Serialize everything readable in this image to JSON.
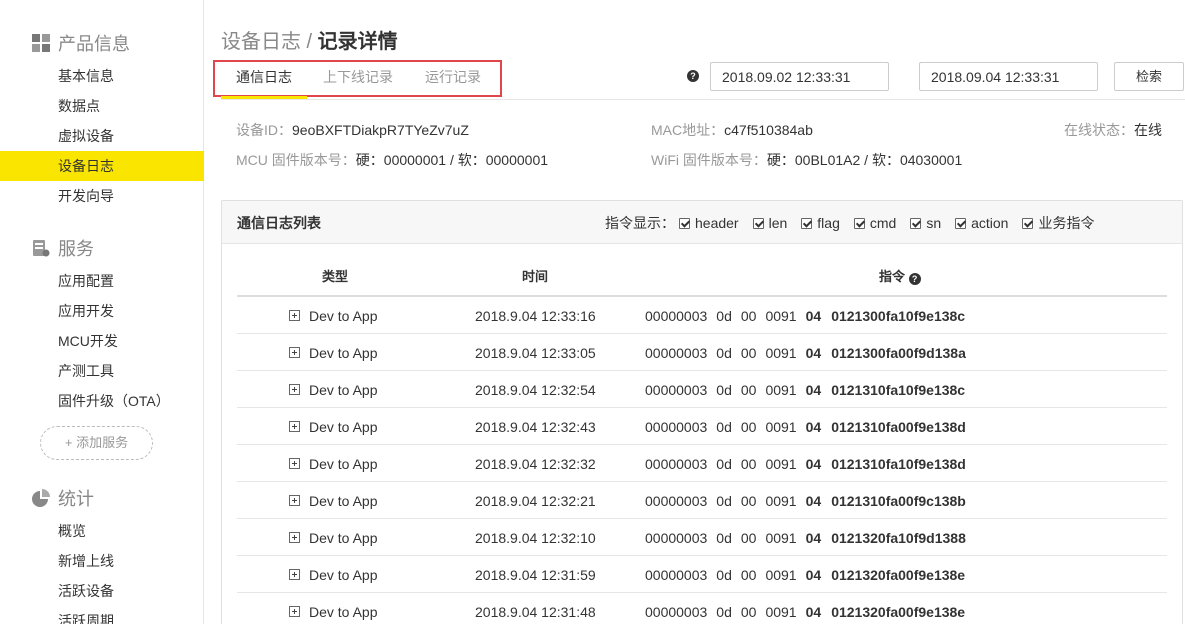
{
  "sidebar": {
    "sections": [
      {
        "title": "产品信息",
        "icon": "grid-icon",
        "items": [
          "基本信息",
          "数据点",
          "虚拟设备",
          "设备日志",
          "开发向导"
        ]
      },
      {
        "title": "服务",
        "icon": "server-icon",
        "items": [
          "应用配置",
          "应用开发",
          "MCU开发",
          "产测工具",
          "固件升级（OTA）"
        ],
        "add_label": "+ 添加服务"
      },
      {
        "title": "统计",
        "icon": "pie-chart-icon",
        "items": [
          "概览",
          "新增上线",
          "活跃设备",
          "活跃周期"
        ]
      }
    ],
    "active_item": "设备日志"
  },
  "header": {
    "title_parent": "设备日志",
    "title_sep": " / ",
    "title_current": "记录详情",
    "tabs": [
      "通信日志",
      "上下线记录",
      "运行记录"
    ],
    "active_tab": "通信日志",
    "help_glyph": "?",
    "date_start": "2018.09.02 12:33:31",
    "date_end": "2018.09.04 12:33:31",
    "search_label": "检索"
  },
  "device": {
    "id_label": "设备ID：",
    "id_value": "9eoBXFTDiakpR7TYeZv7uZ",
    "mac_label": "MAC地址：",
    "mac_value": "c47f510384ab",
    "status_label": "在线状态：",
    "status_value": "在线",
    "mcu_label": "MCU 固件版本号：",
    "mcu_value": "硬：00000001 / 软：00000001",
    "wifi_label": "WiFi 固件版本号：",
    "wifi_value": "硬：00BL01A2 / 软：04030001"
  },
  "log": {
    "panel_title": "通信日志列表",
    "filter_label": "指令显示：",
    "filters": [
      "header",
      "len",
      "flag",
      "cmd",
      "sn",
      "action",
      "业务指令"
    ],
    "columns": [
      "类型",
      "时间",
      "指令"
    ],
    "rows": [
      {
        "type": "Dev to App",
        "time": "2018.9.04 12:33:16",
        "header": "00000003",
        "len": "0d",
        "flag": "00",
        "cmd": "0091",
        "action": "04",
        "payload": "0121300fa10f9e138c"
      },
      {
        "type": "Dev to App",
        "time": "2018.9.04 12:33:05",
        "header": "00000003",
        "len": "0d",
        "flag": "00",
        "cmd": "0091",
        "action": "04",
        "payload": "0121300fa00f9d138a"
      },
      {
        "type": "Dev to App",
        "time": "2018.9.04 12:32:54",
        "header": "00000003",
        "len": "0d",
        "flag": "00",
        "cmd": "0091",
        "action": "04",
        "payload": "0121310fa10f9e138c"
      },
      {
        "type": "Dev to App",
        "time": "2018.9.04 12:32:43",
        "header": "00000003",
        "len": "0d",
        "flag": "00",
        "cmd": "0091",
        "action": "04",
        "payload": "0121310fa00f9e138d"
      },
      {
        "type": "Dev to App",
        "time": "2018.9.04 12:32:32",
        "header": "00000003",
        "len": "0d",
        "flag": "00",
        "cmd": "0091",
        "action": "04",
        "payload": "0121310fa10f9e138d"
      },
      {
        "type": "Dev to App",
        "time": "2018.9.04 12:32:21",
        "header": "00000003",
        "len": "0d",
        "flag": "00",
        "cmd": "0091",
        "action": "04",
        "payload": "0121310fa00f9c138b"
      },
      {
        "type": "Dev to App",
        "time": "2018.9.04 12:32:10",
        "header": "00000003",
        "len": "0d",
        "flag": "00",
        "cmd": "0091",
        "action": "04",
        "payload": "0121320fa10f9d1388"
      },
      {
        "type": "Dev to App",
        "time": "2018.9.04 12:31:59",
        "header": "00000003",
        "len": "0d",
        "flag": "00",
        "cmd": "0091",
        "action": "04",
        "payload": "0121320fa00f9e138e"
      },
      {
        "type": "Dev to App",
        "time": "2018.9.04 12:31:48",
        "header": "00000003",
        "len": "0d",
        "flag": "00",
        "cmd": "0091",
        "action": "04",
        "payload": "0121320fa00f9e138e"
      }
    ]
  },
  "colors": {
    "accent": "#f9e500",
    "highlight_border": "#e0464b"
  }
}
